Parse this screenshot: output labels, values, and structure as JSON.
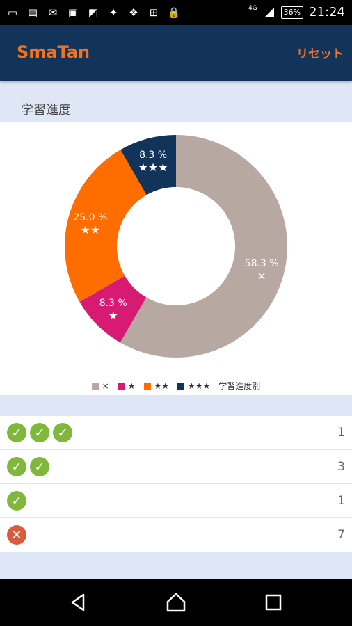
{
  "status_bar": {
    "icons": [
      "message-icon",
      "contact-icon",
      "mail-icon",
      "image-icon",
      "gallery-icon",
      "tool-icon",
      "dropbox-icon",
      "toolbox-icon",
      "lock-icon"
    ],
    "network": "4G",
    "battery": "36%",
    "time": "21:24"
  },
  "app_bar": {
    "title": "SmaTan",
    "reset_label": "リセット"
  },
  "section_title": "学習進度",
  "colors": {
    "none": "#b7a9a2",
    "one": "#d81b72",
    "two": "#ff6d00",
    "three": "#12345b",
    "check": "#7fb83a",
    "cross": "#dc5a3e"
  },
  "chart_data": {
    "type": "pie",
    "subtype": "donut",
    "categories": [
      "×",
      "★",
      "★★",
      "★★★"
    ],
    "values": [
      58.3,
      8.3,
      25.0,
      8.3
    ],
    "labels": [
      "58.3 %",
      "8.3 %",
      "25.0 %",
      "8.3 %"
    ],
    "colors": [
      "#b7a9a2",
      "#d81b72",
      "#ff6d00",
      "#12345b"
    ],
    "legend_title": "学習進度別"
  },
  "rows": [
    {
      "type": "check",
      "marks": 3,
      "count": "1"
    },
    {
      "type": "check",
      "marks": 2,
      "count": "3"
    },
    {
      "type": "check",
      "marks": 1,
      "count": "1"
    },
    {
      "type": "cross",
      "marks": 1,
      "count": "7"
    }
  ]
}
